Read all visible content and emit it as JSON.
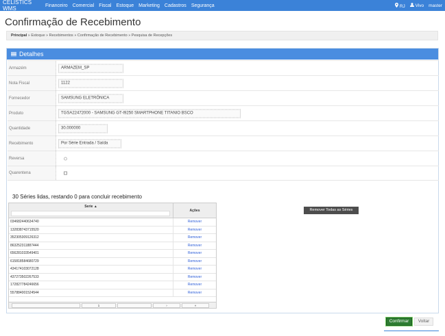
{
  "app": {
    "brand": "CELISTICS WMS",
    "nav": [
      "Financeiro",
      "Comercial",
      "Fiscal",
      "Estoque",
      "Marketing",
      "Cadastros",
      "Segurança"
    ],
    "location": "RJ",
    "user_status": "Vivo",
    "user": "master"
  },
  "page": {
    "title": "Confirmação de Recebimento",
    "breadcrumb_root": "Principal",
    "breadcrumb_rest": " » Estoque » Recebimentos » Confirmação de Recebimento » Pesquisa de Recepções"
  },
  "panel": {
    "title": "Detalhes"
  },
  "form": {
    "armazem_label": "Armazém",
    "armazem_value": "ARMAZEM_SP",
    "nota_label": "Nota Fiscal",
    "nota_value": "1122",
    "fornecedor_label": "Fornecedor",
    "fornecedor_value": "SAMSUNG ELETRÔNICA",
    "produto_label": "Produto",
    "produto_value": "TGSA22472000 - SAMSUNG GT-I9250 SMARTPHONE TITANIO BSCO",
    "quantidade_label": "Quantidade",
    "quantidade_value": "30.000000",
    "recebimento_label": "Recebimento",
    "recebimento_value": "Por Série Entrada / Saída",
    "reversa_label": "Reversa",
    "quarentena_label": "Quarentena"
  },
  "series": {
    "summary": "30 Séries lidas, restando 0 para concluir recebimento",
    "col_serie": "Serie ▲",
    "col_acoes": "Ações",
    "rows": [
      {
        "serie": "034682440634740",
        "acao": "Remover"
      },
      {
        "serie": "132838743715520",
        "acao": "Remover"
      },
      {
        "serie": "352305309126312",
        "acao": "Remover"
      },
      {
        "serie": "863252311887444",
        "acao": "Remover"
      },
      {
        "serie": "656281033549401",
        "acao": "Remover"
      },
      {
        "serie": "615818584680729",
        "acao": "Remover"
      },
      {
        "serie": "434174103072128",
        "acao": "Remover"
      },
      {
        "serie": "437273502267533",
        "acao": "Remover"
      },
      {
        "serie": "172827784246656",
        "acao": "Remover"
      },
      {
        "serie": "557884001524544",
        "acao": "Remover"
      }
    ],
    "pager": {
      "prev": "‹",
      "page": "1",
      "next": "›",
      "last": "»"
    },
    "remove_all": "Remover Todas as Séries"
  },
  "actions": {
    "confirm": "Confirmar",
    "back": "Voltar"
  }
}
